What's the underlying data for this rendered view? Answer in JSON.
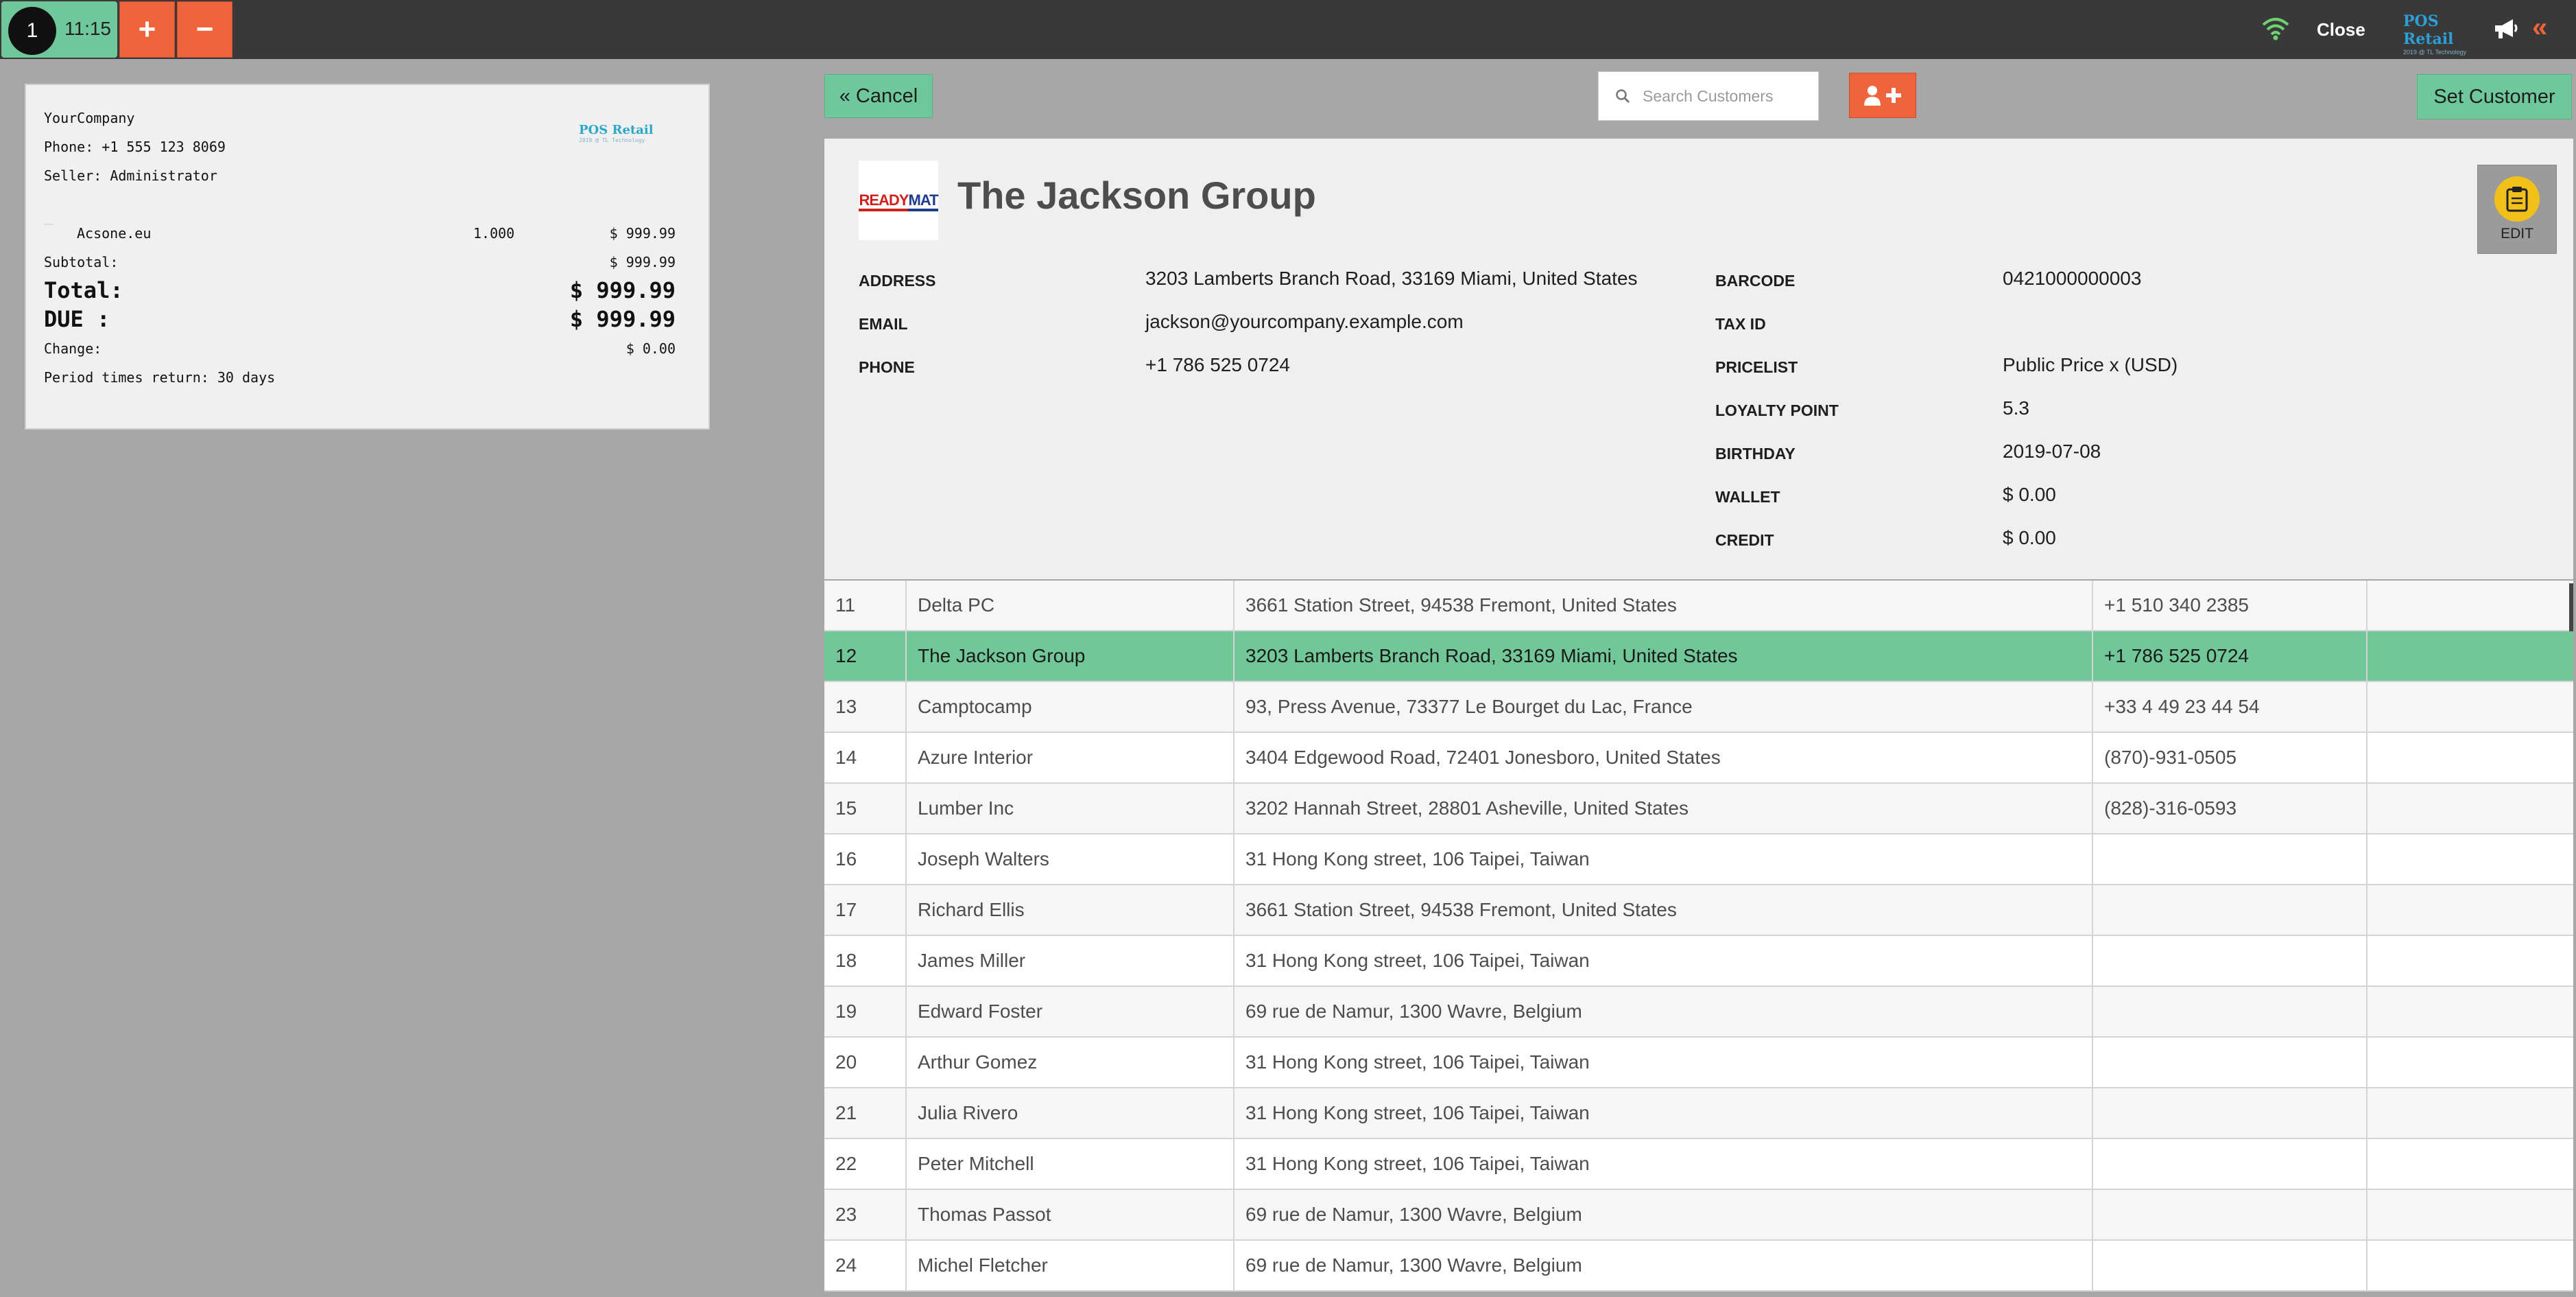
{
  "topbar": {
    "order_number": "1",
    "order_time": "11:15",
    "add_order_label": "+",
    "remove_order_label": "−",
    "close_label": "Close",
    "brand_main": "POS Retail",
    "brand_sub": "2019 @ TL Technology"
  },
  "receipt": {
    "company": "YourCompany",
    "phone": "Phone: +1 555 123 8069",
    "seller": "Seller: Administrator",
    "line_product": "Acsone.eu",
    "line_qty": "1.000",
    "line_price": "$ 999.99",
    "subtotal_label": "Subtotal:",
    "subtotal_value": "$ 999.99",
    "total_label": "Total:",
    "total_value": "$ 999.99",
    "due_label": "DUE :",
    "due_value": "$ 999.99",
    "change_label": "Change:",
    "change_value": "$ 0.00",
    "return_note": "Period times return: 30 days",
    "logo_main": "POS Retail",
    "logo_sub": "2019 @ TL Technology"
  },
  "actions": {
    "cancel_label": "Cancel",
    "search_placeholder": "Search Customers",
    "set_customer_label": "Set Customer"
  },
  "customer": {
    "logo_text_a": "READY",
    "logo_text_b": "MAT",
    "name": "The Jackson Group",
    "edit_label": "EDIT",
    "address_label": "ADDRESS",
    "address": "3203 Lamberts Branch Road, 33169 Miami, United States",
    "email_label": "EMAIL",
    "email": "jackson@yourcompany.example.com",
    "phone_label": "PHONE",
    "phone": "+1 786 525 0724",
    "barcode_label": "BARCODE",
    "barcode": "0421000000003",
    "taxid_label": "TAX ID",
    "pricelist_label": "PRICELIST",
    "pricelist": "Public Price x (USD)",
    "loyalty_label": "LOYALTY POINT",
    "loyalty": "5.3",
    "birthday_label": "BIRTHDAY",
    "birthday": "2019-07-08",
    "wallet_label": "WALLET",
    "wallet": "$ 0.00",
    "credit_label": "CREDIT",
    "credit": "$ 0.00"
  },
  "customers": [
    {
      "id": "11",
      "name": "Delta PC",
      "address": "3661 Station Street, 94538 Fremont, United States",
      "phone": "+1 510 340 2385"
    },
    {
      "id": "12",
      "name": "The Jackson Group",
      "address": "3203 Lamberts Branch Road, 33169 Miami, United States",
      "phone": "+1 786 525 0724",
      "selected": true
    },
    {
      "id": "13",
      "name": "Camptocamp",
      "address": "93, Press Avenue, 73377 Le Bourget du Lac, France",
      "phone": "+33 4 49 23 44 54"
    },
    {
      "id": "14",
      "name": "Azure Interior",
      "address": "3404 Edgewood Road, 72401 Jonesboro, United States",
      "phone": "(870)-931-0505"
    },
    {
      "id": "15",
      "name": "Lumber Inc",
      "address": "3202 Hannah Street, 28801 Asheville, United States",
      "phone": "(828)-316-0593"
    },
    {
      "id": "16",
      "name": "Joseph Walters",
      "address": "31 Hong Kong street, 106 Taipei, Taiwan",
      "phone": ""
    },
    {
      "id": "17",
      "name": "Richard Ellis",
      "address": "3661 Station Street, 94538 Fremont, United States",
      "phone": ""
    },
    {
      "id": "18",
      "name": "James Miller",
      "address": "31 Hong Kong street, 106 Taipei, Taiwan",
      "phone": ""
    },
    {
      "id": "19",
      "name": "Edward Foster",
      "address": "69 rue de Namur, 1300 Wavre, Belgium",
      "phone": ""
    },
    {
      "id": "20",
      "name": "Arthur Gomez",
      "address": "31 Hong Kong street, 106 Taipei, Taiwan",
      "phone": ""
    },
    {
      "id": "21",
      "name": "Julia Rivero",
      "address": "31 Hong Kong street, 106 Taipei, Taiwan",
      "phone": ""
    },
    {
      "id": "22",
      "name": "Peter Mitchell",
      "address": "31 Hong Kong street, 106 Taipei, Taiwan",
      "phone": ""
    },
    {
      "id": "23",
      "name": "Thomas Passot",
      "address": "69 rue de Namur, 1300 Wavre, Belgium",
      "phone": ""
    },
    {
      "id": "24",
      "name": "Michel Fletcher",
      "address": "69 rue de Namur, 1300 Wavre, Belgium",
      "phone": ""
    }
  ],
  "colors": {
    "accent_green": "#6ec89b",
    "accent_orange": "#f0643c",
    "topbar": "#393939",
    "background": "#a7a7a7"
  }
}
